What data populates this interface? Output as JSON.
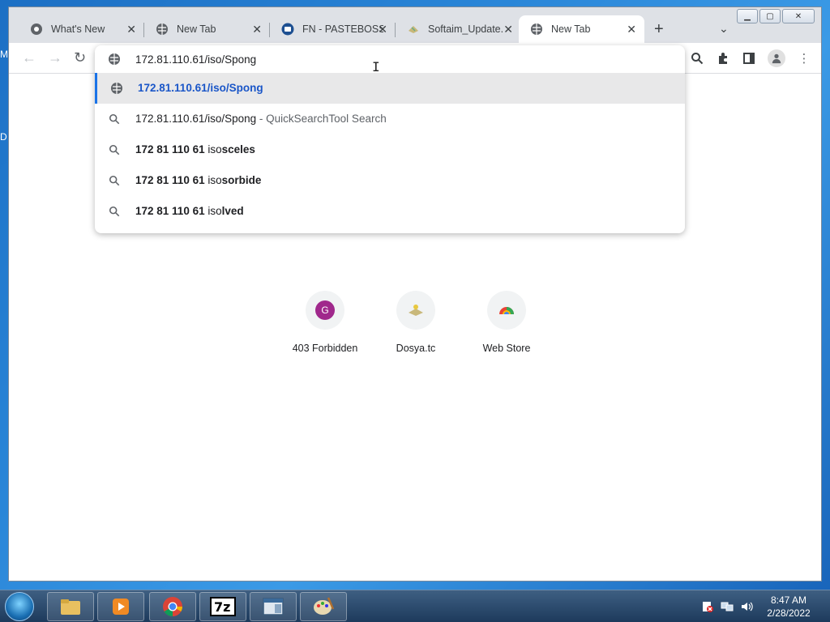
{
  "desktop": {
    "edge_letters": [
      "M",
      "D"
    ]
  },
  "tabs": [
    {
      "title": "What's New",
      "icon": "chrome-icon",
      "active": false
    },
    {
      "title": "New Tab",
      "icon": "globe-icon",
      "active": false
    },
    {
      "title": "FN - PASTEBOSS",
      "icon": "pasteboss-icon",
      "active": false
    },
    {
      "title": "Softaim_Update.",
      "icon": "file-icon",
      "active": false
    },
    {
      "title": "New Tab",
      "icon": "globe-icon",
      "active": true
    }
  ],
  "omnibox": {
    "value": "172.81.110.61/iso/Spong",
    "suggestions": [
      {
        "type": "url",
        "text": "172.81.110.61/iso/Spong",
        "suffix": "",
        "selected": true
      },
      {
        "type": "search",
        "text": "172.81.110.61/iso/Spong",
        "suffix": " - QuickSearchTool Search",
        "selected": false
      },
      {
        "type": "search",
        "prefix": "172 81 110 61 ",
        "plain": "iso",
        "bold": "sceles"
      },
      {
        "type": "search",
        "prefix": "172 81 110 61 ",
        "plain": "iso",
        "bold": "sorbide"
      },
      {
        "type": "search",
        "prefix": "172 81 110 61 ",
        "plain": "iso",
        "bold": "lved"
      }
    ]
  },
  "shortcuts": [
    {
      "label": "403 Forbidden",
      "icon_letter": "G"
    },
    {
      "label": "Dosya.tc",
      "icon": "dosya-icon"
    },
    {
      "label": "Web Store",
      "icon": "webstore-icon"
    }
  ],
  "taskbar": {
    "clock_time": "8:47 AM",
    "clock_date": "2/28/2022",
    "colors": {
      "accent": "#1a73e8",
      "selected_row": "#e8e8e9"
    }
  }
}
